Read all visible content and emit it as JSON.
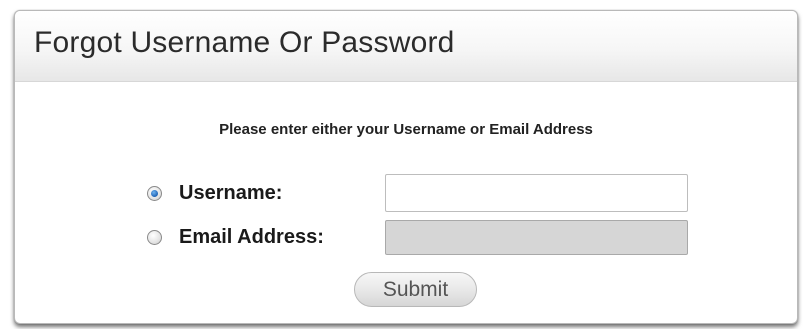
{
  "dialog": {
    "title": "Forgot Username Or Password",
    "instruction": "Please enter either your Username or Email Address"
  },
  "form": {
    "options": [
      {
        "label": "Username:",
        "selected": true
      },
      {
        "label": "Email Address:",
        "selected": false
      }
    ],
    "username_value": "",
    "email_value": "",
    "submit_label": "Submit"
  },
  "colors": {
    "radio_selected": "#1f63b5",
    "disabled_field": "#d6d6d6",
    "button_text": "#555555"
  },
  "icons": {
    "username_radio": "radio-selected-icon",
    "email_radio": "radio-unselected-icon"
  }
}
